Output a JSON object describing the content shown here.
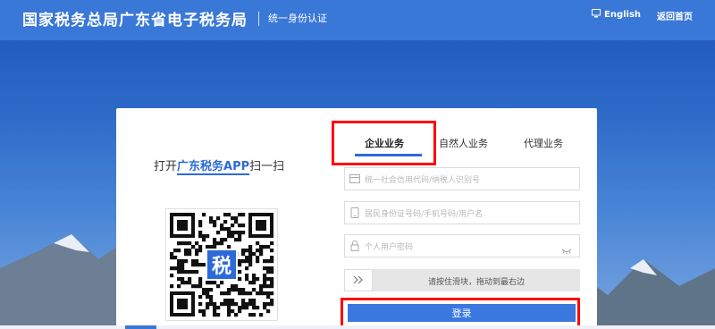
{
  "header": {
    "title": "国家税务总局广东省电子税务局",
    "subtitle": "统一身份认证",
    "language_label": "English",
    "home_label": "返回首页"
  },
  "qr": {
    "prefix": "打开",
    "app_name": "广东税务APP",
    "suffix": "扫一扫",
    "logo_char": "税"
  },
  "tabs": [
    {
      "label": "企业业务",
      "active": true
    },
    {
      "label": "自然人业务",
      "active": false
    },
    {
      "label": "代理业务",
      "active": false
    }
  ],
  "form": {
    "credit_code_placeholder": "统一社会信用代码/纳税人识别号",
    "account_placeholder": "居民身份证号码/手机号码/用户名",
    "password_placeholder": "个人用户密码",
    "slider_text": "请按住滑块，拖动到最右边",
    "login_label": "登录"
  },
  "colors": {
    "accent": "#2d6ad9",
    "header_bg": "#3a78d8",
    "highlight": "#ff0000"
  },
  "icons": [
    "monitor-icon",
    "card-icon",
    "phone-icon",
    "lock-icon",
    "eye-closed-icon",
    "double-chevron-right-icon"
  ]
}
